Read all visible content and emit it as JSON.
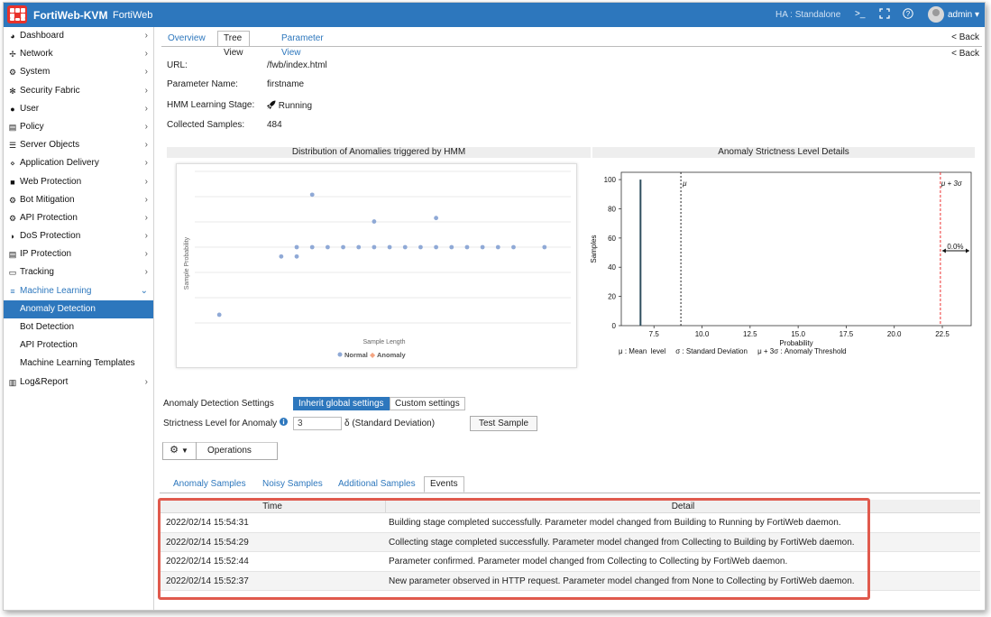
{
  "topbar": {
    "app_name": "FortiWeb-KVM",
    "app_sub": "FortiWeb",
    "ha_label": "HA :",
    "ha_value": "Standalone",
    "terminal_icon": ">_",
    "user": "admin",
    "brand_color": "#2d77bd"
  },
  "sidebar": {
    "items": [
      {
        "label": "Dashboard",
        "icon": "dashboard-icon"
      },
      {
        "label": "Network",
        "icon": "network-icon"
      },
      {
        "label": "System",
        "icon": "gear-icon"
      },
      {
        "label": "Security Fabric",
        "icon": "fabric-icon"
      },
      {
        "label": "User",
        "icon": "user-icon"
      },
      {
        "label": "Policy",
        "icon": "policy-icon"
      },
      {
        "label": "Server Objects",
        "icon": "server-icon"
      },
      {
        "label": "Application Delivery",
        "icon": "delivery-icon"
      },
      {
        "label": "Web Protection",
        "icon": "lock-icon"
      },
      {
        "label": "Bot Mitigation",
        "icon": "bot-icon"
      },
      {
        "label": "API Protection",
        "icon": "api-icon"
      },
      {
        "label": "DoS Protection",
        "icon": "shield-icon"
      },
      {
        "label": "IP Protection",
        "icon": "ip-icon"
      },
      {
        "label": "Tracking",
        "icon": "laptop-icon"
      },
      {
        "label": "Machine Learning",
        "icon": "list-icon"
      }
    ],
    "ml_sub": [
      "Anomaly Detection",
      "Bot Detection",
      "API Protection",
      "Machine Learning Templates"
    ],
    "last_item": {
      "label": "Log&Report",
      "icon": "chart-bar-icon"
    }
  },
  "tabs_top": [
    "Overview",
    "Tree View",
    "Parameter View"
  ],
  "back_label": "< Back",
  "details": {
    "url_label": "URL:",
    "url_value": "/fwb/index.html",
    "param_label": "Parameter Name:",
    "param_value": "firstname",
    "stage_label": "HMM Learning Stage:",
    "stage_value": "Running",
    "samples_label": "Collected Samples:",
    "samples_value": "484"
  },
  "chart_data": [
    {
      "type": "scatter",
      "title": "Distribution of Anomalies triggered by HMM",
      "xlabel": "Sample Length",
      "ylabel": "Sample Probability",
      "legend": [
        "Normal",
        "Anomaly"
      ],
      "series": [
        {
          "name": "Normal",
          "points": [
            [
              1,
              0.02
            ],
            [
              5,
              0.52
            ],
            [
              6,
              0.6
            ],
            [
              6,
              0.52
            ],
            [
              7,
              1.05
            ],
            [
              7,
              0.6
            ],
            [
              8,
              0.6
            ],
            [
              9,
              0.6
            ],
            [
              10,
              0.6
            ],
            [
              11,
              0.6
            ],
            [
              11,
              0.82
            ],
            [
              12,
              0.6
            ],
            [
              13,
              0.6
            ],
            [
              14,
              0.6
            ],
            [
              15,
              0.6
            ],
            [
              15,
              0.85
            ],
            [
              16,
              0.6
            ],
            [
              17,
              0.6
            ],
            [
              18,
              0.6
            ],
            [
              19,
              0.6
            ],
            [
              20,
              0.6
            ],
            [
              22,
              0.6
            ]
          ]
        },
        {
          "name": "Anomaly",
          "points": []
        }
      ],
      "colors": {
        "Normal": "#8fa9d6",
        "Anomaly": "#f4a582"
      }
    },
    {
      "type": "bar",
      "title": "Anomaly Strictness Level Details",
      "xlabel": "Probability",
      "ylabel": "Samples",
      "xlim": [
        5.8,
        24.0
      ],
      "ylim": [
        0,
        105
      ],
      "xticks": [
        7.5,
        10.0,
        12.5,
        15.0,
        17.5,
        20.0,
        22.5
      ],
      "yticks": [
        0,
        20,
        40,
        60,
        80,
        100
      ],
      "bars": [
        {
          "x": 6.8,
          "value": 100
        }
      ],
      "mean_line": {
        "x": 8.9,
        "label": "μ"
      },
      "threshold_line": {
        "x": 22.4,
        "label": "μ + 3σ"
      },
      "arrow_label": "0.0%",
      "legend_text": "μ : Mean  level     σ : Standard Deviation     μ + 3σ : Anomaly Threshold"
    }
  ],
  "settings": {
    "ad_label": "Anomaly Detection Settings",
    "inherit_label": "Inherit global settings",
    "custom_label": "Custom settings",
    "strict_label": "Strictness Level for Anomaly",
    "strict_value": "3",
    "strict_unit": "δ (Standard Deviation)",
    "test_label": "Test Sample",
    "operations_label": "Operations"
  },
  "tabs_bottom": [
    "Anomaly Samples",
    "Noisy Samples",
    "Additional Samples",
    "Events"
  ],
  "events": {
    "columns": [
      "Time",
      "Detail"
    ],
    "rows": [
      {
        "time": "2022/02/14 15:54:31",
        "detail": "Building stage completed successfully. Parameter model changed from Building to Running by FortiWeb daemon."
      },
      {
        "time": "2022/02/14 15:54:29",
        "detail": "Collecting stage completed successfully. Parameter model changed from Collecting to Building by FortiWeb daemon."
      },
      {
        "time": "2022/02/14 15:52:44",
        "detail": "Parameter confirmed. Parameter model changed from Collecting to Collecting by FortiWeb daemon."
      },
      {
        "time": "2022/02/14 15:52:37",
        "detail": "New parameter observed in HTTP request. Parameter model changed from None to Collecting by FortiWeb daemon."
      }
    ]
  }
}
